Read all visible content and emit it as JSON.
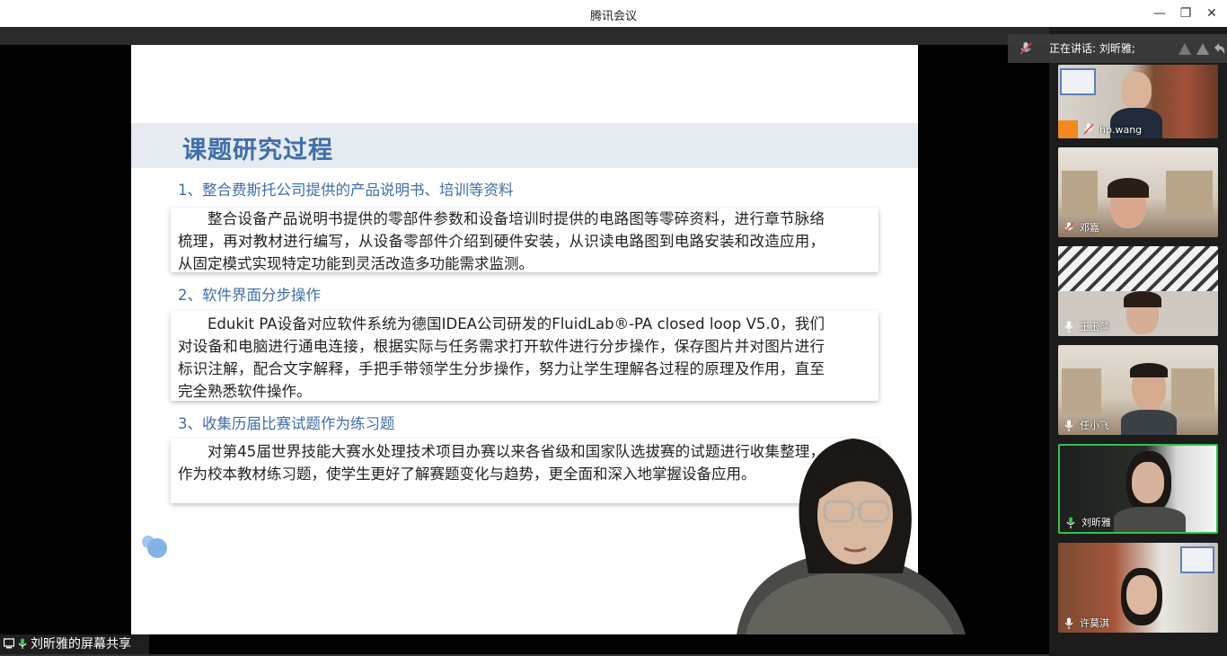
{
  "window": {
    "title": "腾讯会议",
    "minimize": "—",
    "restore": "❐",
    "close": "✕"
  },
  "slide": {
    "title": "课题研究过程",
    "sections": [
      {
        "heading": "1、整合费斯托公司提供的产品说明书、培训等资料",
        "body": "整合设备产品说明书提供的零部件参数和设备培训时提供的电路图等零碎资料，进行章节脉络梳理，再对教材进行编写，从设备零部件介绍到硬件安装，从识读电路图到电路安装和改造应用，从固定模式实现特定功能到灵活改造多功能需求监测。"
      },
      {
        "heading": "2、软件界面分步操作",
        "body": "Edukit PA设备对应软件系统为德国IDEA公司研发的FluidLab®-PA closed loop V5.0，我们对设备和电脑进行通电连接，根据实际与任务需求打开软件进行分步操作，保存图片并对图片进行标识注解，配合文字解释，手把手带领学生分步操作，努力让学生理解各过程的原理及作用，直至完全熟悉软件操作。"
      },
      {
        "heading": "3、收集历届比赛试题作为练习题",
        "body": "对第45届世界技能大赛水处理技术项目办赛以来各省级和国家队选拔赛的试题进行收集整理，作为校本教材练习题，使学生更好了解赛题变化与趋势，更全面和深入地掌握设备应用。"
      }
    ]
  },
  "share_label": "刘昕雅的屏幕共享",
  "speaking": {
    "label": "正在讲话: 刘昕雅;"
  },
  "participants": [
    {
      "name": "hp.wang",
      "mic": "muted",
      "has_avatar_badge": true
    },
    {
      "name": "邓嘉",
      "mic": "muted"
    },
    {
      "name": "王玉萍",
      "mic": "on"
    },
    {
      "name": "任小飞",
      "mic": "on"
    },
    {
      "name": "刘昕雅",
      "mic": "active",
      "active": true
    },
    {
      "name": "许莫淇",
      "mic": "on"
    }
  ],
  "colors": {
    "accent": "#3f6fa8",
    "active_speaker": "#33c24d",
    "badge": "#f28a20"
  }
}
